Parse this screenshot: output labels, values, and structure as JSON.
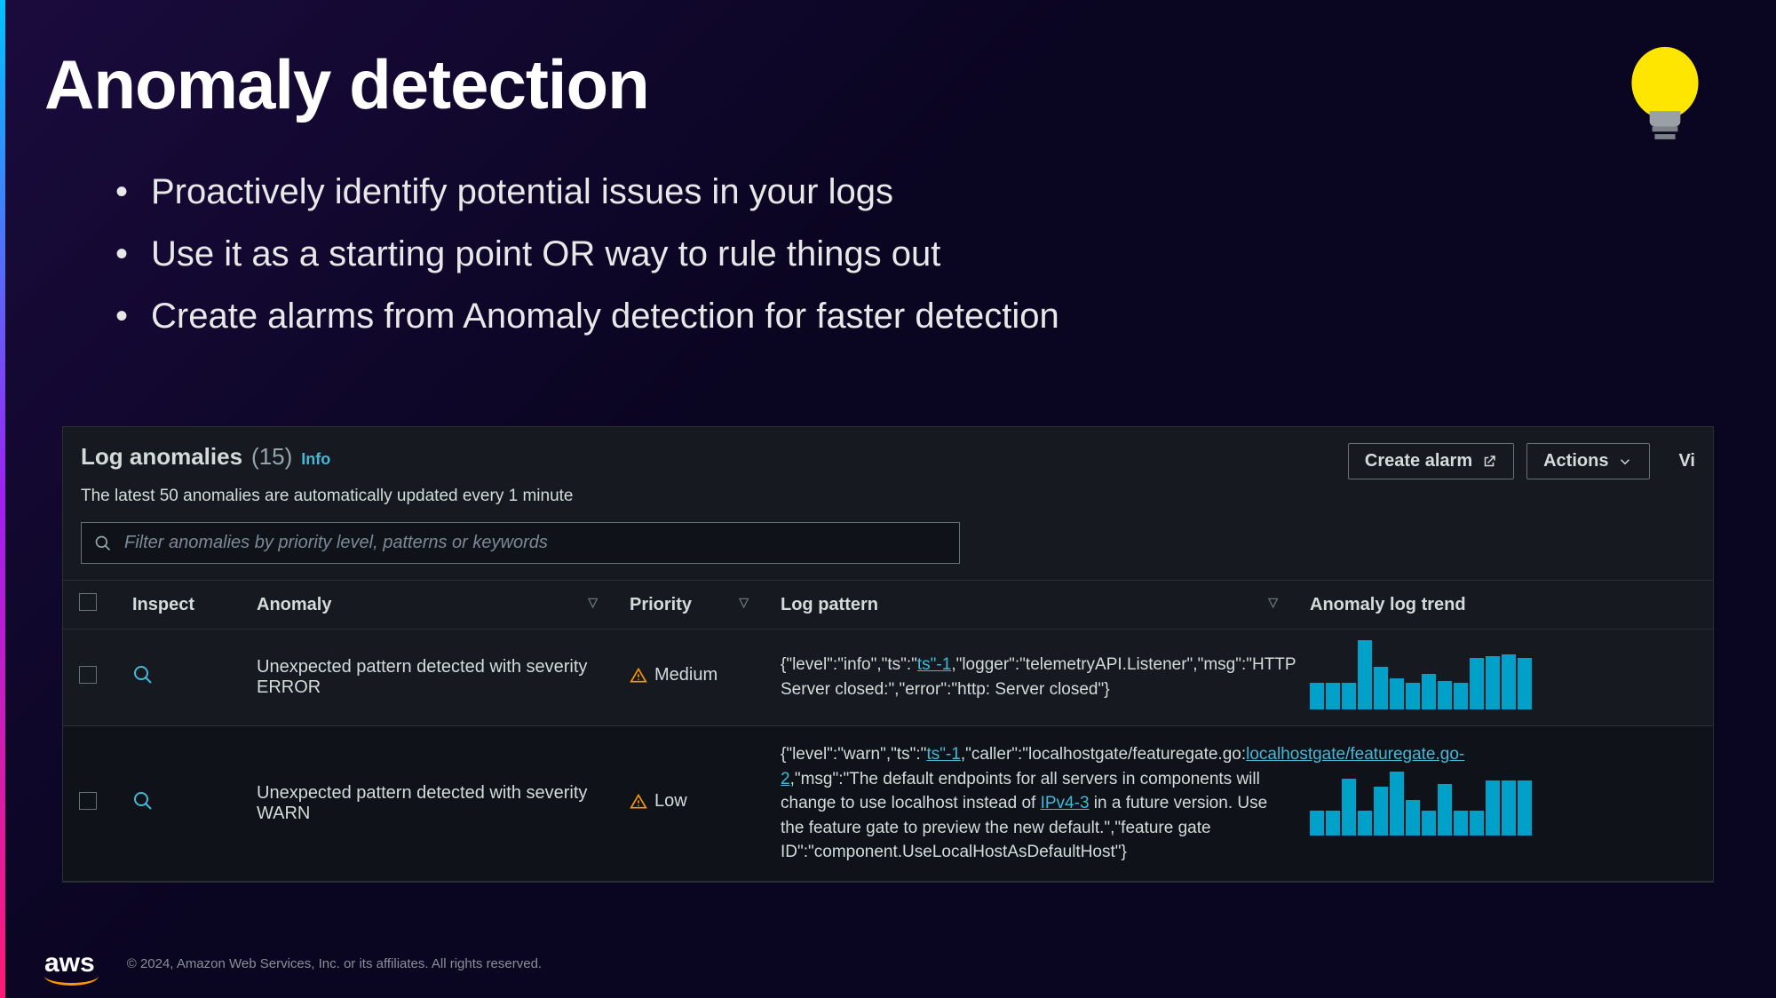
{
  "slide": {
    "title": "Anomaly detection",
    "bullets": [
      "Proactively identify potential issues in your logs",
      "Use it as a starting point OR way to rule things out",
      "Create alarms from Anomaly detection for faster detection"
    ]
  },
  "panel": {
    "title": "Log anomalies",
    "count": "(15)",
    "info": "Info",
    "subtitle": "The latest 50 anomalies are automatically updated every 1 minute",
    "buttons": {
      "create_alarm": "Create alarm",
      "actions": "Actions",
      "view": "Vi"
    },
    "search_placeholder": "Filter anomalies by priority level, patterns or keywords",
    "columns": {
      "inspect": "Inspect",
      "anomaly": "Anomaly",
      "priority": "Priority",
      "log_pattern": "Log pattern",
      "trend": "Anomaly log trend"
    },
    "rows": [
      {
        "anomaly": "Unexpected pattern detected with severity ERROR",
        "priority": "Medium",
        "log_pattern_parts": [
          {
            "t": "{\"level\":\"info\",\"ts\":\""
          },
          {
            "t": "ts\"-1",
            "link": true
          },
          {
            "t": ",\"logger\":\"telemetryAPI.Listener\",\"msg\":\"HTTP Server closed:\",\"error\":\"http: Server closed\"}"
          }
        ],
        "spark": [
          30,
          30,
          30,
          78,
          48,
          35,
          30,
          40,
          32,
          30,
          58,
          60,
          62,
          58
        ]
      },
      {
        "anomaly": "Unexpected pattern detected with severity WARN",
        "priority": "Low",
        "log_pattern_parts": [
          {
            "t": "{\"level\":\"warn\",\"ts\":\""
          },
          {
            "t": "ts\"-1",
            "link": true
          },
          {
            "t": ",\"caller\":\"localhostgate/featuregate.go:"
          },
          {
            "t": "localhostgate/featuregate.go-2",
            "link": true
          },
          {
            "t": ",\"msg\":\"The default endpoints for all servers in components will change to use localhost instead of "
          },
          {
            "t": "IPv4-3",
            "link": true
          },
          {
            "t": " in a future version. Use the feature gate to preview the new default.\",\"feature gate ID\":\"component.UseLocalHostAsDefaultHost\"}"
          }
        ],
        "spark": [
          28,
          28,
          64,
          28,
          55,
          72,
          40,
          28,
          58,
          28,
          28,
          62,
          62,
          62
        ]
      }
    ]
  },
  "footer": {
    "logo": "aws",
    "copyright": "© 2024, Amazon Web Services, Inc. or its affiliates. All rights reserved."
  }
}
